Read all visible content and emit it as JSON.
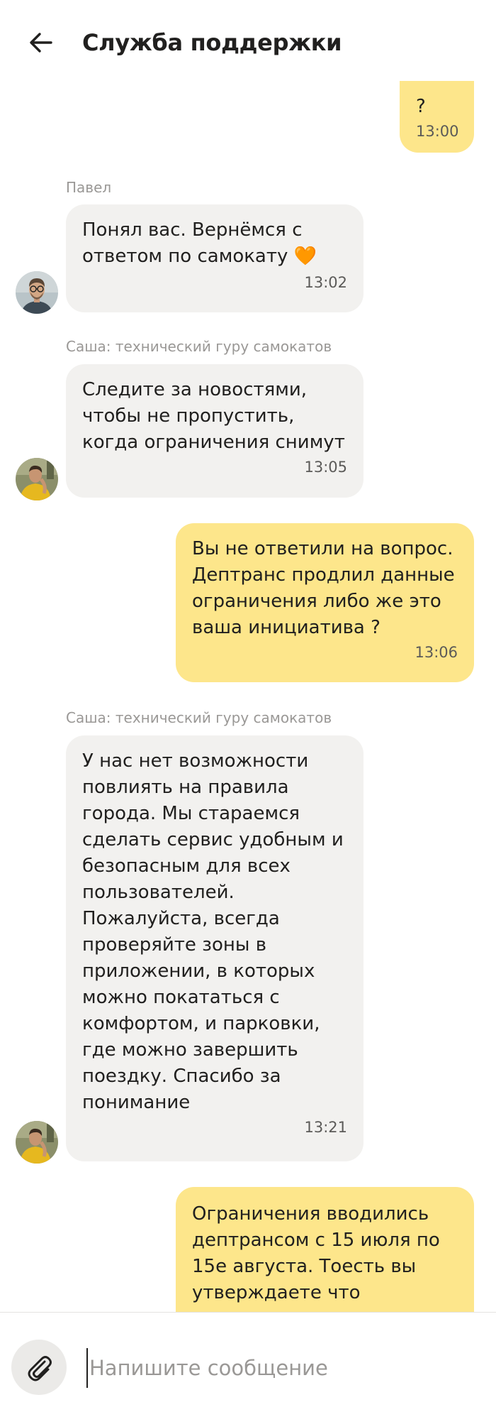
{
  "header": {
    "title": "Служба поддержки",
    "back_icon": "arrow-left-icon"
  },
  "messages": [
    {
      "direction": "out",
      "text": "?",
      "time": "13:00"
    },
    {
      "direction": "in",
      "sender": "Павел",
      "text": "Понял вас. Вернёмся с ответом по самокату 🧡",
      "time": "13:02",
      "avatar": "man-with-glasses-avatar"
    },
    {
      "direction": "in",
      "sender": "Саша: технический гуру самокатов",
      "text": "Следите за новостями, чтобы не пропустить, когда ограничения снимут",
      "time": "13:05",
      "avatar": "person-in-yellow-avatar"
    },
    {
      "direction": "out",
      "text": "Вы не ответили на вопрос. Дептранс продлил данные ограничения либо же это ваша инициатива ?",
      "time": "13:06"
    },
    {
      "direction": "in",
      "sender": "Саша: технический гуру самокатов",
      "text": "У нас нет возможности повлиять на правила города. Мы стараемся сделать сервис удобным и безопасным для всех пользователей. Пожалуйста, всегда проверяйте зоны в приложении, в которых можно покататься с комфортом, и парковки, где можно завершить поездку. Спасибо за понимание",
      "time": "13:21",
      "avatar": "person-in-yellow-avatar"
    },
    {
      "direction": "out",
      "text": "Ограничения вводились дептрансом с 15 июля по 15е августа. Тоесть вы утверждаете что дептранс"
    }
  ],
  "composer": {
    "placeholder": "Напишите сообщение",
    "value": "",
    "attach_icon": "paperclip-icon"
  },
  "colors": {
    "outgoing_bubble": "#fde68b",
    "incoming_bubble": "#f2f1ef",
    "meta_text": "#9a9896"
  }
}
